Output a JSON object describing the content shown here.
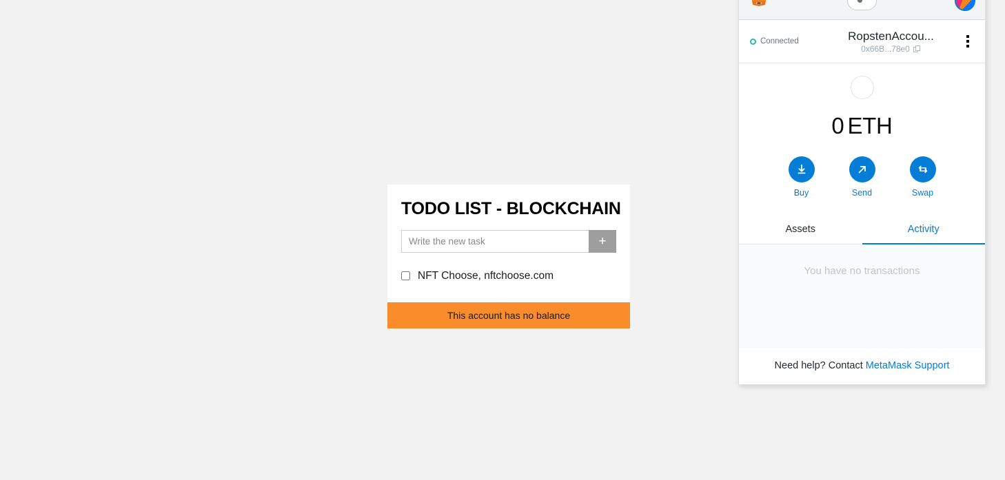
{
  "page": {
    "background_color": "#f2f2f2"
  },
  "todo_app": {
    "title": "TODO LIST - BLOCKCHAIN",
    "input": {
      "value": "",
      "placeholder": "Write the new task"
    },
    "add_button_label": "+",
    "tasks": [
      {
        "label": "NFT Choose, nftchoose.com",
        "checked": false
      }
    ],
    "banner": {
      "text": "This account has no balance",
      "color": "#fa8c2c"
    }
  },
  "metamask": {
    "appbar": {
      "logo_name": "MetaMask",
      "network": {
        "label": "",
        "dot_color": "#6a737d"
      }
    },
    "account": {
      "connection_status": "Connected",
      "connection_color": "#29b6af",
      "name": "RopstenAccou...",
      "address": "0x66B...78e0",
      "menu_label": ""
    },
    "balance": {
      "amount": "0",
      "unit": "ETH"
    },
    "actions": [
      {
        "label": "Buy",
        "icon": "download-icon"
      },
      {
        "label": "Send",
        "icon": "arrow-up-right-icon"
      },
      {
        "label": "Swap",
        "icon": "swap-icon"
      }
    ],
    "tabs": [
      {
        "label": "Assets",
        "active": false
      },
      {
        "label": "Activity",
        "active": true
      }
    ],
    "activity": {
      "empty_text": "You have no transactions"
    },
    "support": {
      "prefix": "Need help? Contact",
      "link": "MetaMask Support"
    },
    "accent_color": "#037dd6"
  }
}
